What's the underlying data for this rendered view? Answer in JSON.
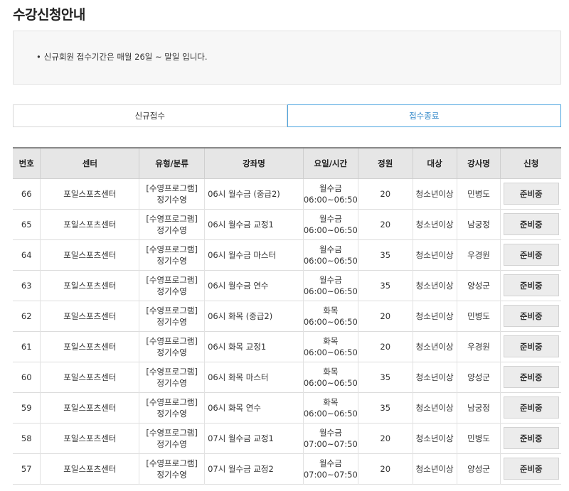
{
  "page_title": "수강신청안내",
  "notice": {
    "bullet": "•",
    "text": "신규회원 접수기간은 매월 26일 ~ 말일 입니다."
  },
  "tabs": [
    {
      "label": "신규접수",
      "active": false
    },
    {
      "label": "접수종료",
      "active": true
    }
  ],
  "table": {
    "headers": [
      "번호",
      "센터",
      "유형/분류",
      "강좌명",
      "요일/시간",
      "정원",
      "대상",
      "강사명",
      "신청"
    ],
    "rows": [
      {
        "no": "66",
        "center": "포일스포츠센터",
        "type_top": "[수영프로그램]",
        "type_bottom": "정기수영",
        "course": "06시 월수금 (중급2)",
        "days": "월수금",
        "time": "06:00~06:50",
        "capacity": "20",
        "target": "청소년이상",
        "instructor": "민병도",
        "status": "준비중"
      },
      {
        "no": "65",
        "center": "포일스포츠센터",
        "type_top": "[수영프로그램]",
        "type_bottom": "정기수영",
        "course": "06시 월수금 교정1",
        "days": "월수금",
        "time": "06:00~06:50",
        "capacity": "20",
        "target": "청소년이상",
        "instructor": "남궁정",
        "status": "준비중"
      },
      {
        "no": "64",
        "center": "포일스포츠센터",
        "type_top": "[수영프로그램]",
        "type_bottom": "정기수영",
        "course": "06시 월수금 마스터",
        "days": "월수금",
        "time": "06:00~06:50",
        "capacity": "35",
        "target": "청소년이상",
        "instructor": "우경원",
        "status": "준비중"
      },
      {
        "no": "63",
        "center": "포일스포츠센터",
        "type_top": "[수영프로그램]",
        "type_bottom": "정기수영",
        "course": "06시 월수금 연수",
        "days": "월수금",
        "time": "06:00~06:50",
        "capacity": "35",
        "target": "청소년이상",
        "instructor": "양성군",
        "status": "준비중"
      },
      {
        "no": "62",
        "center": "포일스포츠센터",
        "type_top": "[수영프로그램]",
        "type_bottom": "정기수영",
        "course": "06시 화목 (중급2)",
        "days": "화목",
        "time": "06:00~06:50",
        "capacity": "20",
        "target": "청소년이상",
        "instructor": "민병도",
        "status": "준비중"
      },
      {
        "no": "61",
        "center": "포일스포츠센터",
        "type_top": "[수영프로그램]",
        "type_bottom": "정기수영",
        "course": "06시 화목 교정1",
        "days": "화목",
        "time": "06:00~06:50",
        "capacity": "20",
        "target": "청소년이상",
        "instructor": "우경원",
        "status": "준비중"
      },
      {
        "no": "60",
        "center": "포일스포츠센터",
        "type_top": "[수영프로그램]",
        "type_bottom": "정기수영",
        "course": "06시 화목 마스터",
        "days": "화목",
        "time": "06:00~06:50",
        "capacity": "35",
        "target": "청소년이상",
        "instructor": "양성군",
        "status": "준비중"
      },
      {
        "no": "59",
        "center": "포일스포츠센터",
        "type_top": "[수영프로그램]",
        "type_bottom": "정기수영",
        "course": "06시 화목 연수",
        "days": "화목",
        "time": "06:00~06:50",
        "capacity": "35",
        "target": "청소년이상",
        "instructor": "남궁정",
        "status": "준비중"
      },
      {
        "no": "58",
        "center": "포일스포츠센터",
        "type_top": "[수영프로그램]",
        "type_bottom": "정기수영",
        "course": "07시 월수금 교정1",
        "days": "월수금",
        "time": "07:00~07:50",
        "capacity": "20",
        "target": "청소년이상",
        "instructor": "민병도",
        "status": "준비중"
      },
      {
        "no": "57",
        "center": "포일스포츠센터",
        "type_top": "[수영프로그램]",
        "type_bottom": "정기수영",
        "course": "07시 월수금 교정2",
        "days": "월수금",
        "time": "07:00~07:50",
        "capacity": "20",
        "target": "청소년이상",
        "instructor": "양성군",
        "status": "준비중"
      }
    ]
  },
  "colors": {
    "active_tab": "#2e86c8",
    "header_bg": "#e6e6e6",
    "notice_bg": "#f7f7f7"
  }
}
